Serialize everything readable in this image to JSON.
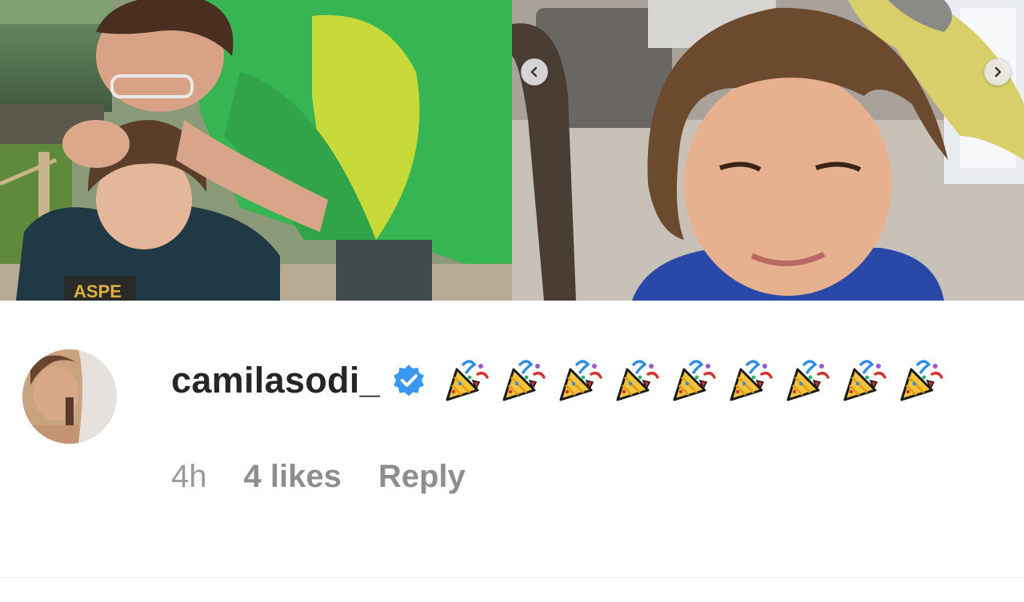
{
  "carousel": {
    "prev_icon": "chevron-left-icon",
    "next_icon": "chevron-right-icon"
  },
  "comment": {
    "username": "camilasodi_",
    "verified": true,
    "verified_icon": "verified-badge-icon",
    "verified_color": "#3897f0",
    "emoji": "🎉🎉🎉🎉🎉🎉🎉🎉🎉",
    "emoji_icon": "party-popper-icon",
    "emoji_count": 9,
    "time": "4h",
    "likes": "4 likes",
    "reply": "Reply"
  }
}
